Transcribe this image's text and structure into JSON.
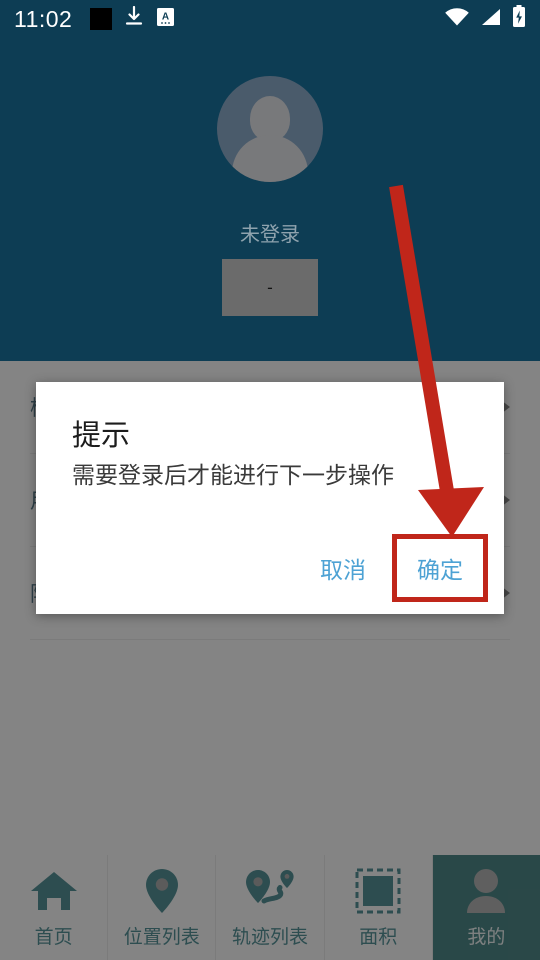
{
  "statusbar": {
    "time": "11:02",
    "icons_left": [
      "black-square-icon",
      "download-icon",
      "text-box-a-icon"
    ],
    "icons_right": [
      "wifi-icon",
      "cellular-signal-icon",
      "battery-charging-icon"
    ]
  },
  "profile": {
    "avatar_icon": "default-user-avatar",
    "username": "未登录",
    "action_button_label": "-"
  },
  "list": {
    "rows": [
      {
        "label": "检测升级",
        "chevron": "chevron-right-icon"
      },
      {
        "label": "用户协议",
        "chevron": "chevron-right-icon"
      },
      {
        "label": "隐私协议",
        "chevron": "chevron-right-icon"
      }
    ]
  },
  "bottomnav": {
    "items": [
      {
        "label": "首页",
        "icon": "home-icon",
        "active": false
      },
      {
        "label": "位置列表",
        "icon": "map-pin-icon",
        "active": false
      },
      {
        "label": "轨迹列表",
        "icon": "track-route-icon",
        "active": false
      },
      {
        "label": "面积",
        "icon": "dashed-square-icon",
        "active": false
      },
      {
        "label": "我的",
        "icon": "person-icon",
        "active": true
      }
    ]
  },
  "dialog": {
    "title": "提示",
    "message": "需要登录后才能进行下一步操作",
    "cancel_label": "取消",
    "confirm_label": "确定"
  },
  "annotation": {
    "arrow": "red-arrow-pointing-to-confirm",
    "highlight": "red-box-around-confirm"
  },
  "colors": {
    "header_teal": "#0d3d54",
    "nav_active_teal": "#0d5c5c",
    "link_blue": "#4da2d4",
    "annotation_red": "#c0261a",
    "list_text": "#19485c"
  }
}
